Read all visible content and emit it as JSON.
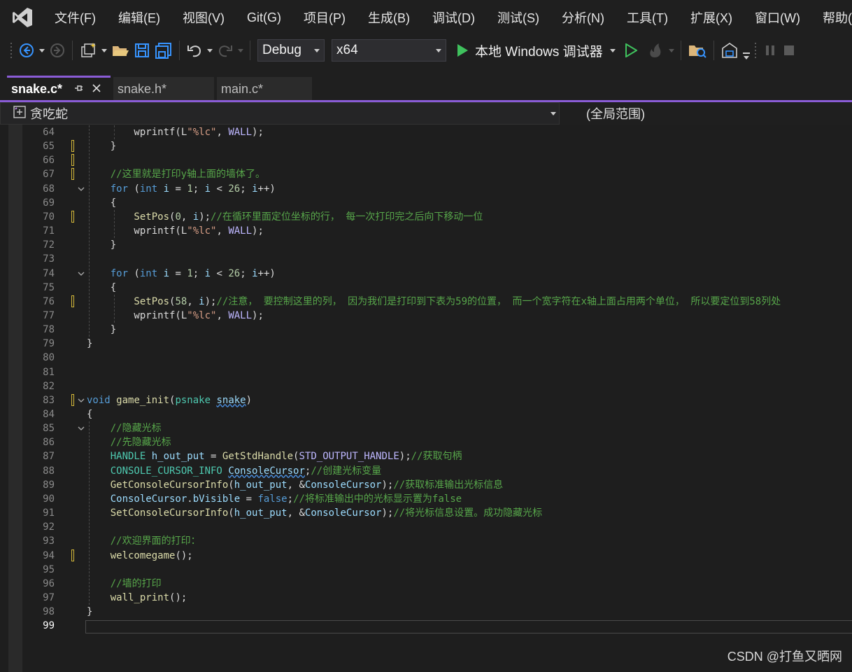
{
  "menu": [
    "文件(F)",
    "编辑(E)",
    "视图(V)",
    "Git(G)",
    "项目(P)",
    "生成(B)",
    "调试(D)",
    "测试(S)",
    "分析(N)",
    "工具(T)",
    "扩展(X)",
    "窗口(W)",
    "帮助(H)"
  ],
  "toolbar": {
    "config": "Debug",
    "platform": "x64",
    "run_label": "本地 Windows 调试器"
  },
  "tabs": [
    {
      "label": "snake.c*",
      "active": true
    },
    {
      "label": "snake.h*",
      "active": false
    },
    {
      "label": "main.c*",
      "active": false
    }
  ],
  "nav": {
    "project": "贪吃蛇",
    "scope": "(全局范围)"
  },
  "code_lines": [
    {
      "n": "64",
      "tokens": [
        [
          "pl",
          "        wprintf(L"
        ],
        [
          "str",
          "\"%lc\""
        ],
        [
          "pl",
          ", "
        ],
        [
          "mac",
          "WALL"
        ],
        [
          "pl",
          ");"
        ]
      ]
    },
    {
      "n": "65",
      "tokens": [
        [
          "pl",
          "    }"
        ]
      ]
    },
    {
      "n": "66",
      "tokens": []
    },
    {
      "n": "67",
      "tokens": [
        [
          "cmt",
          "    //这里就是打印y轴上面的墙体了。"
        ]
      ]
    },
    {
      "n": "68",
      "tokens": [
        [
          "kw",
          "    for"
        ],
        [
          "pl",
          " ("
        ],
        [
          "kw",
          "int"
        ],
        [
          "pl",
          " "
        ],
        [
          "var",
          "i"
        ],
        [
          "pl",
          " = "
        ],
        [
          "num",
          "1"
        ],
        [
          "pl",
          "; "
        ],
        [
          "var",
          "i"
        ],
        [
          "pl",
          " < "
        ],
        [
          "num",
          "26"
        ],
        [
          "pl",
          "; "
        ],
        [
          "var",
          "i"
        ],
        [
          "pl",
          "++)"
        ]
      ]
    },
    {
      "n": "69",
      "tokens": [
        [
          "pl",
          "    {"
        ]
      ]
    },
    {
      "n": "70",
      "tokens": [
        [
          "fn",
          "        SetPos"
        ],
        [
          "pl",
          "("
        ],
        [
          "num",
          "0"
        ],
        [
          "pl",
          ", "
        ],
        [
          "var",
          "i"
        ],
        [
          "pl",
          ");"
        ],
        [
          "cmt",
          "//在循环里面定位坐标的行， 每一次打印完之后向下移动一位"
        ]
      ]
    },
    {
      "n": "71",
      "tokens": [
        [
          "pl",
          "        wprintf(L"
        ],
        [
          "str",
          "\"%lc\""
        ],
        [
          "pl",
          ", "
        ],
        [
          "mac",
          "WALL"
        ],
        [
          "pl",
          ");"
        ]
      ]
    },
    {
      "n": "72",
      "tokens": [
        [
          "pl",
          "    }"
        ]
      ]
    },
    {
      "n": "73",
      "tokens": []
    },
    {
      "n": "74",
      "tokens": [
        [
          "kw",
          "    for"
        ],
        [
          "pl",
          " ("
        ],
        [
          "kw",
          "int"
        ],
        [
          "pl",
          " "
        ],
        [
          "var",
          "i"
        ],
        [
          "pl",
          " = "
        ],
        [
          "num",
          "1"
        ],
        [
          "pl",
          "; "
        ],
        [
          "var",
          "i"
        ],
        [
          "pl",
          " < "
        ],
        [
          "num",
          "26"
        ],
        [
          "pl",
          "; "
        ],
        [
          "var",
          "i"
        ],
        [
          "pl",
          "++)"
        ]
      ]
    },
    {
      "n": "75",
      "tokens": [
        [
          "pl",
          "    {"
        ]
      ]
    },
    {
      "n": "76",
      "tokens": [
        [
          "fn",
          "        SetPos"
        ],
        [
          "pl",
          "("
        ],
        [
          "num",
          "58"
        ],
        [
          "pl",
          ", "
        ],
        [
          "var",
          "i"
        ],
        [
          "pl",
          ");"
        ],
        [
          "cmt",
          "//注意， 要控制这里的列， 因为我们是打印到下表为59的位置， 而一个宽字符在x轴上面占用两个单位， 所以要定位到58列处"
        ]
      ]
    },
    {
      "n": "77",
      "tokens": [
        [
          "pl",
          "        wprintf(L"
        ],
        [
          "str",
          "\"%lc\""
        ],
        [
          "pl",
          ", "
        ],
        [
          "mac",
          "WALL"
        ],
        [
          "pl",
          ");"
        ]
      ]
    },
    {
      "n": "78",
      "tokens": [
        [
          "pl",
          "    }"
        ]
      ]
    },
    {
      "n": "79",
      "tokens": [
        [
          "pl",
          "}"
        ]
      ]
    },
    {
      "n": "80",
      "tokens": []
    },
    {
      "n": "81",
      "tokens": []
    },
    {
      "n": "82",
      "tokens": []
    },
    {
      "n": "83",
      "tokens": [
        [
          "kw",
          "void"
        ],
        [
          "pl",
          " "
        ],
        [
          "fn",
          "game_init"
        ],
        [
          "pl",
          "("
        ],
        [
          "ty",
          "psnake"
        ],
        [
          "pl",
          " "
        ],
        [
          "var",
          "snake"
        ],
        [
          "pl",
          ")"
        ]
      ]
    },
    {
      "n": "84",
      "tokens": [
        [
          "pl",
          "{"
        ]
      ]
    },
    {
      "n": "85",
      "tokens": [
        [
          "cmt",
          "    //隐藏光标"
        ]
      ]
    },
    {
      "n": "86",
      "tokens": [
        [
          "cmt",
          "    //先隐藏光标"
        ]
      ]
    },
    {
      "n": "87",
      "tokens": [
        [
          "ty",
          "    HANDLE"
        ],
        [
          "pl",
          " "
        ],
        [
          "var",
          "h_out_put"
        ],
        [
          "pl",
          " = "
        ],
        [
          "fn",
          "GetStdHandle"
        ],
        [
          "pl",
          "("
        ],
        [
          "mac",
          "STD_OUTPUT_HANDLE"
        ],
        [
          "pl",
          ");"
        ],
        [
          "cmt",
          "//获取句柄"
        ]
      ]
    },
    {
      "n": "88",
      "tokens": [
        [
          "ty",
          "    CONSOLE_CURSOR_INFO"
        ],
        [
          "pl",
          " "
        ],
        [
          "var",
          "ConsoleCursor"
        ],
        [
          "pl",
          ";"
        ],
        [
          "cmt",
          "//创建光标变量"
        ]
      ]
    },
    {
      "n": "89",
      "tokens": [
        [
          "fn",
          "    GetConsoleCursorInfo"
        ],
        [
          "pl",
          "("
        ],
        [
          "var",
          "h_out_put"
        ],
        [
          "pl",
          ", &"
        ],
        [
          "var",
          "ConsoleCursor"
        ],
        [
          "pl",
          ");"
        ],
        [
          "cmt",
          "//获取标准输出光标信息"
        ]
      ]
    },
    {
      "n": "90",
      "tokens": [
        [
          "var",
          "    ConsoleCursor"
        ],
        [
          "pl",
          "."
        ],
        [
          "var",
          "bVisible"
        ],
        [
          "pl",
          " = "
        ],
        [
          "kw",
          "false"
        ],
        [
          "pl",
          ";"
        ],
        [
          "cmt",
          "//将标准输出中的光标显示置为false"
        ]
      ]
    },
    {
      "n": "91",
      "tokens": [
        [
          "fn",
          "    SetConsoleCursorInfo"
        ],
        [
          "pl",
          "("
        ],
        [
          "var",
          "h_out_put"
        ],
        [
          "pl",
          ", &"
        ],
        [
          "var",
          "ConsoleCursor"
        ],
        [
          "pl",
          ");"
        ],
        [
          "cmt",
          "//将光标信息设置。成功隐藏光标"
        ]
      ]
    },
    {
      "n": "92",
      "tokens": []
    },
    {
      "n": "93",
      "tokens": [
        [
          "cmt",
          "    //欢迎界面的打印："
        ]
      ]
    },
    {
      "n": "94",
      "tokens": [
        [
          "fn",
          "    welcomegame"
        ],
        [
          "pl",
          "();"
        ]
      ]
    },
    {
      "n": "95",
      "tokens": []
    },
    {
      "n": "96",
      "tokens": [
        [
          "cmt",
          "    //墙的打印"
        ]
      ]
    },
    {
      "n": "97",
      "tokens": [
        [
          "fn",
          "    wall_print"
        ],
        [
          "pl",
          "();"
        ]
      ]
    },
    {
      "n": "98",
      "tokens": [
        [
          "pl",
          "}"
        ]
      ]
    },
    {
      "n": "99",
      "tokens": []
    }
  ],
  "changed_lines": [
    "65",
    "66",
    "67",
    "70",
    "76",
    "83",
    "94"
  ],
  "fold_lines": [
    "68",
    "74",
    "83",
    "85"
  ],
  "current_line": "99",
  "watermark": "CSDN @打鱼又晒网"
}
